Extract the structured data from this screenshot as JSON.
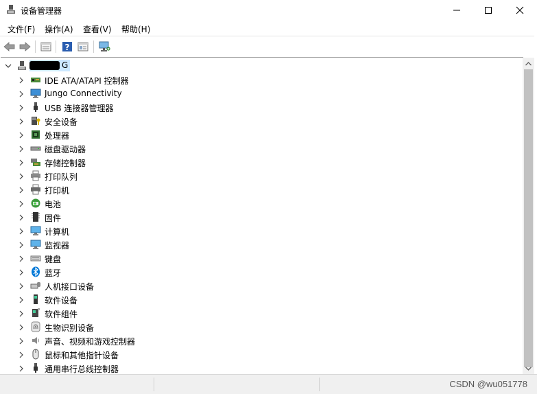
{
  "window": {
    "title": "设备管理器"
  },
  "menu": [
    {
      "label": "文件(F)"
    },
    {
      "label": "操作(A)"
    },
    {
      "label": "查看(V)"
    },
    {
      "label": "帮助(H)"
    }
  ],
  "toolbar": {
    "buttons": [
      "back-icon",
      "forward-icon",
      "properties-view-icon",
      "help-icon",
      "details-view-icon",
      "scan-hardware-icon"
    ]
  },
  "tree": {
    "root_label_visible": "G",
    "items": [
      {
        "label": "IDE ATA/ATAPI 控制器",
        "icon": "ide-controller-icon"
      },
      {
        "label": "Jungo Connectivity",
        "icon": "jungo-monitor-icon"
      },
      {
        "label": "USB 连接器管理器",
        "icon": "usb-plug-icon"
      },
      {
        "label": "安全设备",
        "icon": "security-device-icon"
      },
      {
        "label": "处理器",
        "icon": "processor-icon"
      },
      {
        "label": "磁盘驱动器",
        "icon": "disk-drive-icon"
      },
      {
        "label": "存储控制器",
        "icon": "storage-controller-icon"
      },
      {
        "label": "打印队列",
        "icon": "print-queue-icon"
      },
      {
        "label": "打印机",
        "icon": "printer-icon"
      },
      {
        "label": "电池",
        "icon": "battery-icon"
      },
      {
        "label": "固件",
        "icon": "firmware-icon"
      },
      {
        "label": "计算机",
        "icon": "computer-icon"
      },
      {
        "label": "监视器",
        "icon": "monitor-icon"
      },
      {
        "label": "键盘",
        "icon": "keyboard-icon"
      },
      {
        "label": "蓝牙",
        "icon": "bluetooth-icon"
      },
      {
        "label": "人机接口设备",
        "icon": "hid-icon"
      },
      {
        "label": "软件设备",
        "icon": "software-device-icon"
      },
      {
        "label": "软件组件",
        "icon": "software-component-icon"
      },
      {
        "label": "生物识别设备",
        "icon": "fingerprint-icon"
      },
      {
        "label": "声音、视频和游戏控制器",
        "icon": "speaker-icon"
      },
      {
        "label": "鼠标和其他指针设备",
        "icon": "mouse-icon"
      },
      {
        "label": "通用串行总线控制器",
        "icon": "usb-controller-icon"
      }
    ]
  },
  "status": {
    "watermark": "CSDN @wu051778"
  },
  "colors": {
    "selection": "#cce8ff",
    "scroll_thumb": "#c1c1c1",
    "bluetooth": "#0078d7"
  }
}
